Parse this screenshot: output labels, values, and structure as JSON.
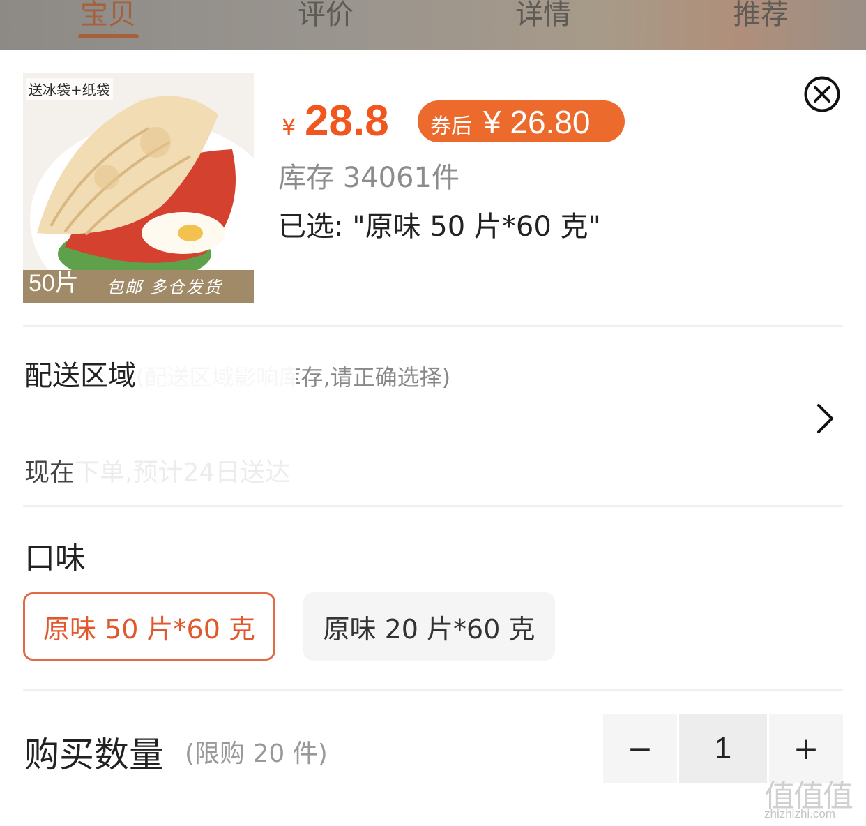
{
  "tabs": [
    {
      "label": "宝贝"
    },
    {
      "label": "评价"
    },
    {
      "label": "详情"
    },
    {
      "label": "推荐"
    }
  ],
  "product": {
    "image_badge_top": "送冰袋+纸袋",
    "image_count": "50片",
    "image_tag": "包邮 多仓发货",
    "currency": "¥",
    "price": "28.8",
    "coupon_label": "券后",
    "coupon_value": "¥ 26.80",
    "stock": "库存 34061件",
    "selected": "已选: \"原味 50 片*60 克\""
  },
  "delivery": {
    "title": "配送区域",
    "subtitle": "(配送区域影响库存,请正确选择)",
    "line2": "现在下单,预计24日送达"
  },
  "flavor": {
    "title": "口味",
    "options": [
      {
        "label": "原味 50 片*60 克",
        "selected": true
      },
      {
        "label": "原味 20 片*60 克",
        "selected": false
      }
    ]
  },
  "quantity": {
    "title": "购买数量",
    "limit": "(限购 20 件)",
    "minus": "−",
    "value": "1",
    "plus": "+"
  },
  "watermark": {
    "big": "值值值",
    "small": "zhizhizhi.com"
  },
  "colors": {
    "accent": "#f0561d",
    "coupon_bg": "#ec6a2c",
    "selected_border": "#e36a46"
  },
  "icons": [
    "close-circle-icon",
    "chevron-right-icon"
  ]
}
